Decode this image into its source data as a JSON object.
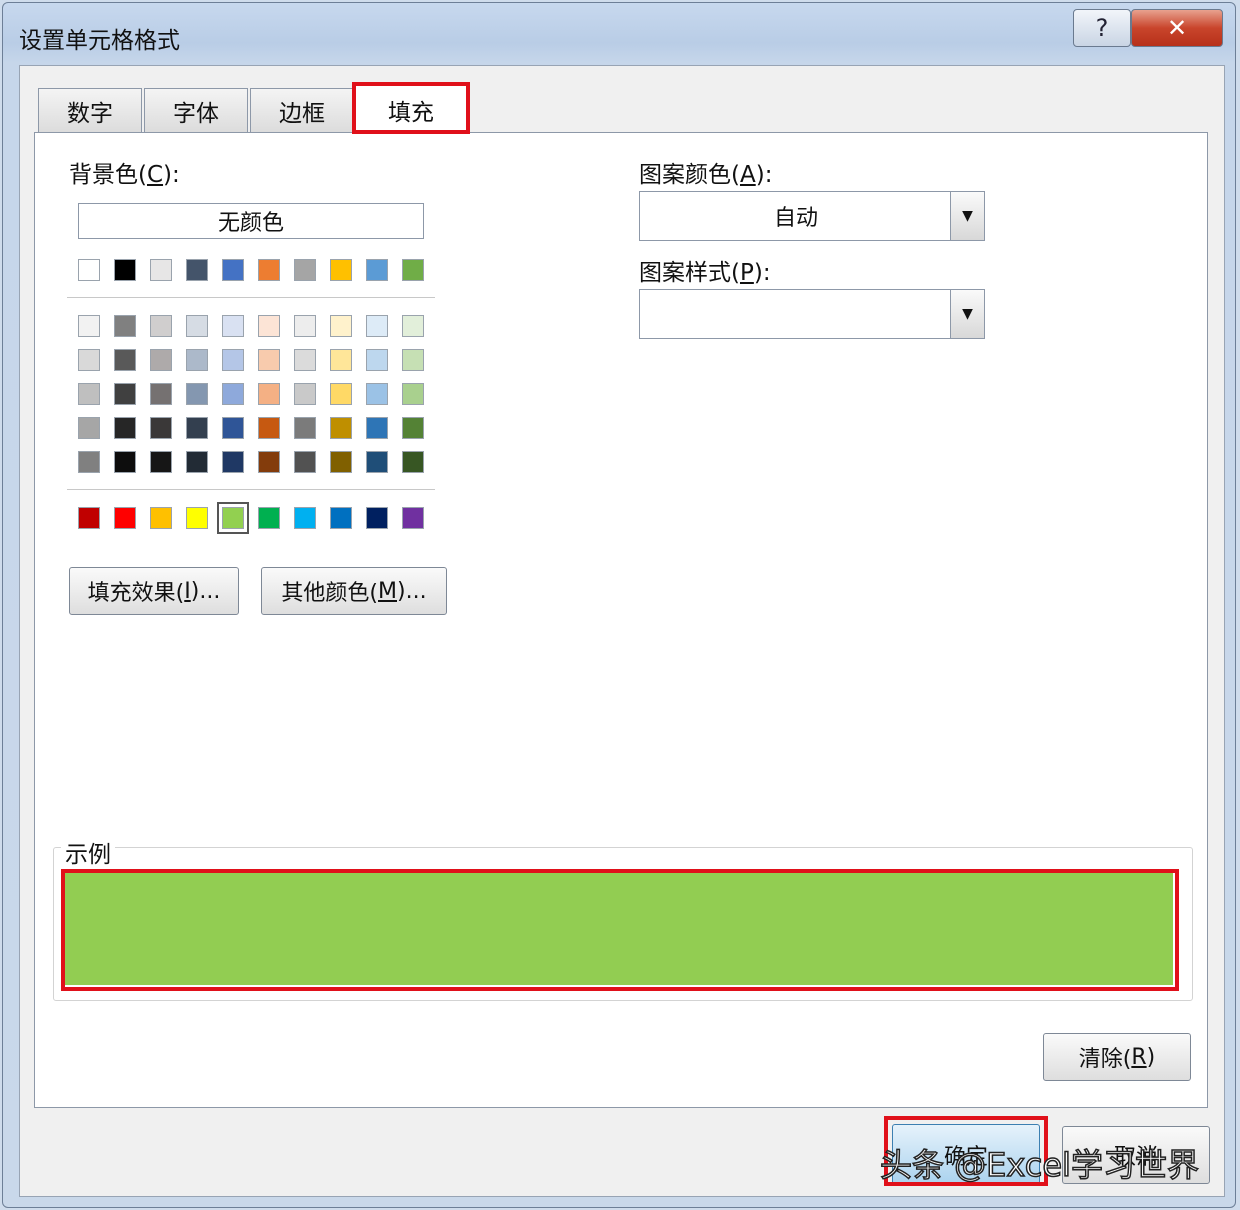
{
  "window": {
    "title": "设置单元格格式"
  },
  "tabs": [
    {
      "label": "数字"
    },
    {
      "label": "字体"
    },
    {
      "label": "边框"
    },
    {
      "label": "填充"
    }
  ],
  "background_color": {
    "label_prefix": "背景色(",
    "label_key": "C",
    "label_suffix": "):",
    "no_color_label": "无颜色",
    "theme_row": [
      "#ffffff",
      "#000000",
      "#e7e6e6",
      "#44546a",
      "#4472c4",
      "#ed7d31",
      "#a5a5a5",
      "#ffc000",
      "#5b9bd5",
      "#70ad47"
    ],
    "shade_rows": [
      [
        "#f2f2f2",
        "#808080",
        "#d0cece",
        "#d6dce4",
        "#d9e1f2",
        "#fce4d6",
        "#ededed",
        "#fff2cc",
        "#ddebf7",
        "#e2efda"
      ],
      [
        "#d9d9d9",
        "#595959",
        "#aeaaaa",
        "#acb9ca",
        "#b4c6e7",
        "#f8cbad",
        "#dbdbdb",
        "#ffe699",
        "#bdd7ee",
        "#c6e0b4"
      ],
      [
        "#bfbfbf",
        "#404040",
        "#757171",
        "#8497b0",
        "#8ea9db",
        "#f4b084",
        "#c9c9c9",
        "#ffd966",
        "#9bc2e6",
        "#a9d08e"
      ],
      [
        "#a6a6a6",
        "#262626",
        "#3a3838",
        "#333f4f",
        "#2f5597",
        "#c65911",
        "#7b7b7b",
        "#bf8f00",
        "#2e75b6",
        "#548235"
      ],
      [
        "#808080",
        "#0d0d0d",
        "#161616",
        "#222b35",
        "#1f3864",
        "#833c0c",
        "#525252",
        "#806000",
        "#1f4e78",
        "#375623"
      ]
    ],
    "standard_row": [
      "#c00000",
      "#ff0000",
      "#ffc000",
      "#ffff00",
      "#92d050",
      "#00b050",
      "#00b0f0",
      "#0070c0",
      "#002060",
      "#7030a0"
    ],
    "selected_standard_index": 4
  },
  "buttons": {
    "fill_effects": {
      "prefix": "填充效果(",
      "key": "I",
      "suffix": ")..."
    },
    "more_colors": {
      "prefix": "其他颜色(",
      "key": "M",
      "suffix": ")..."
    },
    "clear": {
      "prefix": "清除(",
      "key": "R",
      "suffix": ")"
    },
    "ok": "确定",
    "cancel": "取消"
  },
  "pattern_color": {
    "label_prefix": "图案颜色(",
    "label_key": "A",
    "label_suffix": "):",
    "value": "自动"
  },
  "pattern_style": {
    "label_prefix": "图案样式(",
    "label_key": "P",
    "label_suffix": "):",
    "value": ""
  },
  "sample": {
    "label": "示例",
    "color": "#92cd52"
  },
  "watermark": "头条 @Excel学习世界",
  "colors": {
    "highlight": "#e0101a"
  }
}
